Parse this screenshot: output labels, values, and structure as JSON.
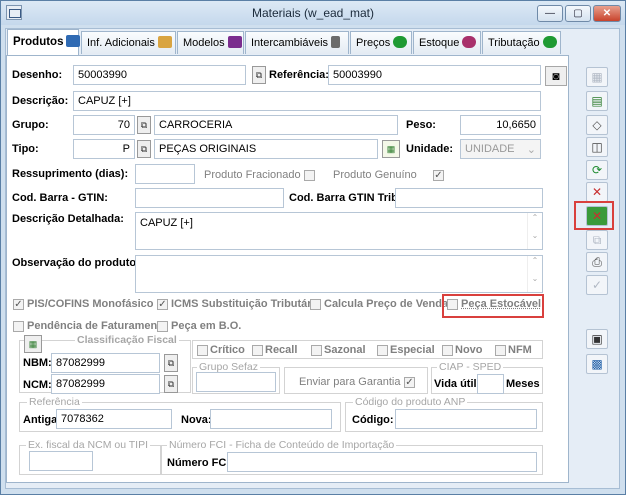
{
  "window": {
    "title": "Materiais (w_ead_mat)",
    "minimize": "—",
    "maximize": "▢",
    "close": "✕"
  },
  "tabs": [
    {
      "label": "Produtos",
      "icon_color": "#2f6ab3"
    },
    {
      "label": "Inf. Adicionais",
      "icon_color": "#d9a441"
    },
    {
      "label": "Modelos",
      "icon_color": "#7a2c8e"
    },
    {
      "label": "Intercambiáveis",
      "icon_color": "#6b6b6b"
    },
    {
      "label": "Preços",
      "icon_color": "#1f9a33"
    },
    {
      "label": "Estoque",
      "icon_color": "#a8306b"
    },
    {
      "label": "Tributação",
      "icon_color": "#1f9a33"
    }
  ],
  "form": {
    "desenho_label": "Desenho:",
    "desenho": "50003990",
    "referencia_label": "Referência:",
    "referencia": "50003990",
    "descricao_label": "Descrição:",
    "descricao": "CAPUZ [+]",
    "grupo_label": "Grupo:",
    "grupo_code": "70",
    "grupo_name": "CARROCERIA",
    "peso_label": "Peso:",
    "peso": "10,6650",
    "tipo_label": "Tipo:",
    "tipo_code": "P",
    "tipo_name": "PEÇAS ORIGINAIS",
    "unidade_label": "Unidade:",
    "unidade": "UNIDADE",
    "ressuprimento_label": "Ressuprimento (dias):",
    "produto_fracionado": "Produto Fracionado",
    "produto_genuino": "Produto Genuíno",
    "cod_barra_label": "Cod. Barra - GTIN:",
    "cod_barra_trib_label": "Cod. Barra GTIN Trib:",
    "descricao_detalhada_label": "Descrição Detalhada:",
    "descricao_detalhada": "CAPUZ [+]",
    "observacao_label": "Observação do produto:",
    "pis_cofins": "PIS/COFINS Monofásico",
    "icms_st": "ICMS Substituição Tributária",
    "calcula_preco": "Calcula Preço de Venda",
    "peca_estocavel": "Peça Estocável",
    "pendencia": "Pendência de Faturamento",
    "peca_bo": "Peça em B.O."
  },
  "classificacao": {
    "title": "Classificação Fiscal",
    "nbm_label": "NBM:",
    "nbm": "87082999",
    "ncm_label": "NCM:",
    "ncm": "87082999"
  },
  "flags": {
    "critico": "Crítico",
    "recall": "Recall",
    "sazonal": "Sazonal",
    "especial": "Especial",
    "novo": "Novo",
    "nfm": "NFM"
  },
  "grupo_sefaz": {
    "title": "Grupo Sefaz",
    "enviar_garantia": "Enviar para Garantia"
  },
  "ciap": {
    "title": "CIAP - SPED",
    "vida_util_label": "Vida útil:",
    "meses": "Meses"
  },
  "referencia_grp": {
    "title": "Referência",
    "antiga_label": "Antiga:",
    "antiga": "7078362",
    "nova_label": "Nova:"
  },
  "anp": {
    "title": "Código do produto ANP",
    "codigo_label": "Código:"
  },
  "ex_fiscal": {
    "title": "Ex. fiscal da NCM ou TIPI"
  },
  "fci": {
    "title": "Número  FCI - Ficha de Conteúdo de Importação",
    "numero_label": "Número FCI:"
  },
  "sidebar_icons": [
    "grid-icon",
    "table-add-icon",
    "eraser-icon",
    "print-preview-icon",
    "refresh-icon",
    "delete-icon",
    "cancel-icon",
    "copy-icon",
    "print-icon",
    "check-icon",
    "save-icon",
    "calculator-icon"
  ]
}
